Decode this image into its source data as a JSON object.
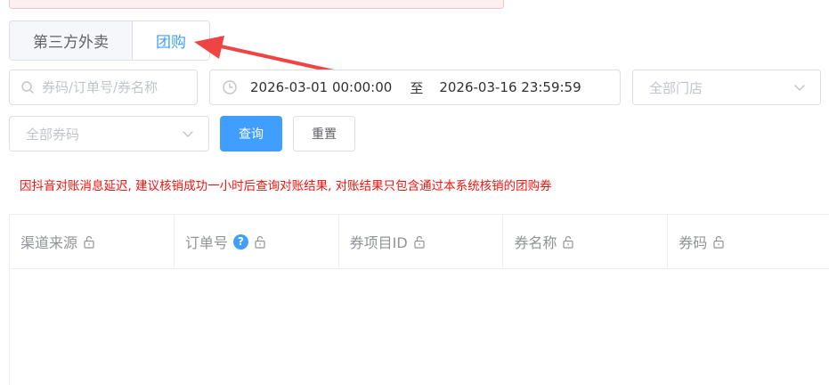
{
  "top_notice": "...",
  "tabs": [
    {
      "label": "第三方外卖",
      "active": false
    },
    {
      "label": "团购",
      "active": true
    }
  ],
  "filters": {
    "search_placeholder": "券码/订单号/券名称",
    "date_start": "2026-03-01 00:00:00",
    "date_separator": "至",
    "date_end": "2026-03-16 23:59:59",
    "store_placeholder": "全部门店",
    "coupon_placeholder": "全部券码"
  },
  "buttons": {
    "query": "查询",
    "reset": "重置"
  },
  "notice": "因抖音对账消息延迟, 建议核销成功一小时后查询对账结果, 对账结果只包含通过本系统核销的团购券",
  "table": {
    "columns": [
      {
        "label": "渠道来源",
        "help": false
      },
      {
        "label": "订单号",
        "help": true
      },
      {
        "label": "券项目ID",
        "help": false
      },
      {
        "label": "券名称",
        "help": false
      },
      {
        "label": "券码",
        "help": false
      }
    ],
    "help_glyph": "?"
  },
  "colors": {
    "primary": "#409eff",
    "warning_text": "#f0140f",
    "annotation_arrow": "#ee4444"
  }
}
